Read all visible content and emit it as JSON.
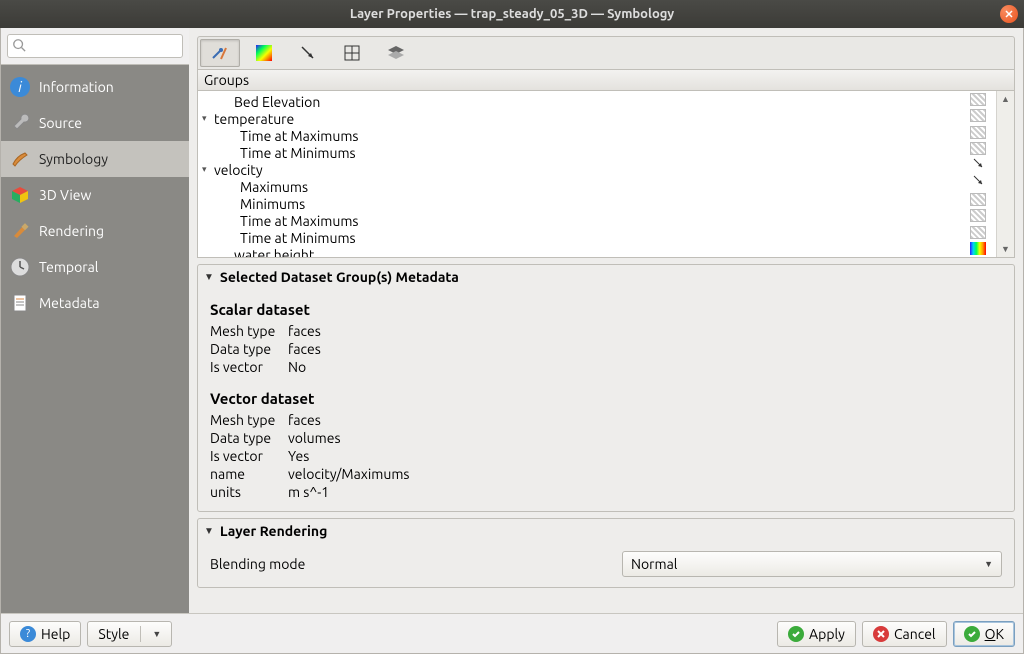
{
  "window": {
    "title": "Layer Properties — trap_steady_05_3D — Symbology"
  },
  "sidebar": {
    "search_placeholder": "",
    "items": [
      {
        "label": "Information"
      },
      {
        "label": "Source"
      },
      {
        "label": "Symbology"
      },
      {
        "label": "3D View"
      },
      {
        "label": "Rendering"
      },
      {
        "label": "Temporal"
      },
      {
        "label": "Metadata"
      }
    ]
  },
  "groups": {
    "header": "Groups",
    "tree": [
      {
        "level": 1,
        "exp": "",
        "label": "Bed Elevation",
        "swatch": "hatch"
      },
      {
        "level": 0,
        "exp": "▾",
        "label": "temperature",
        "swatch": "hatch"
      },
      {
        "level": 2,
        "exp": "",
        "label": "Time at Maximums",
        "swatch": "hatch"
      },
      {
        "level": 2,
        "exp": "",
        "label": "Time at Minimums",
        "swatch": "hatch"
      },
      {
        "level": 0,
        "exp": "▾",
        "label": "velocity",
        "swatch": "arrow"
      },
      {
        "level": 2,
        "exp": "",
        "label": "Maximums",
        "swatch": "arrow"
      },
      {
        "level": 2,
        "exp": "",
        "label": "Minimums",
        "swatch": "hatch"
      },
      {
        "level": 2,
        "exp": "",
        "label": "Time at Maximums",
        "swatch": "hatch"
      },
      {
        "level": 2,
        "exp": "",
        "label": "Time at Minimums",
        "swatch": "hatch"
      },
      {
        "level": 1,
        "exp": "",
        "label": "water  height",
        "swatch": "rainbow"
      }
    ]
  },
  "metadata": {
    "section_title": "Selected Dataset Group(s) Metadata",
    "scalar": {
      "title": "Scalar dataset",
      "rows": [
        {
          "k": "Mesh type",
          "v": "faces"
        },
        {
          "k": "Data type",
          "v": "faces"
        },
        {
          "k": "Is vector",
          "v": "No"
        }
      ]
    },
    "vector": {
      "title": "Vector dataset",
      "rows": [
        {
          "k": "Mesh type",
          "v": "faces"
        },
        {
          "k": "Data type",
          "v": "volumes"
        },
        {
          "k": "Is vector",
          "v": "Yes"
        },
        {
          "k": "name",
          "v": "velocity/Maximums"
        },
        {
          "k": "units",
          "v": "m s^-1"
        }
      ]
    }
  },
  "rendering": {
    "section_title": "Layer Rendering",
    "blend_label": "Blending mode",
    "blend_value": "Normal"
  },
  "footer": {
    "help": "Help",
    "style": "Style",
    "apply": "Apply",
    "cancel": "Cancel",
    "ok": "OK"
  }
}
